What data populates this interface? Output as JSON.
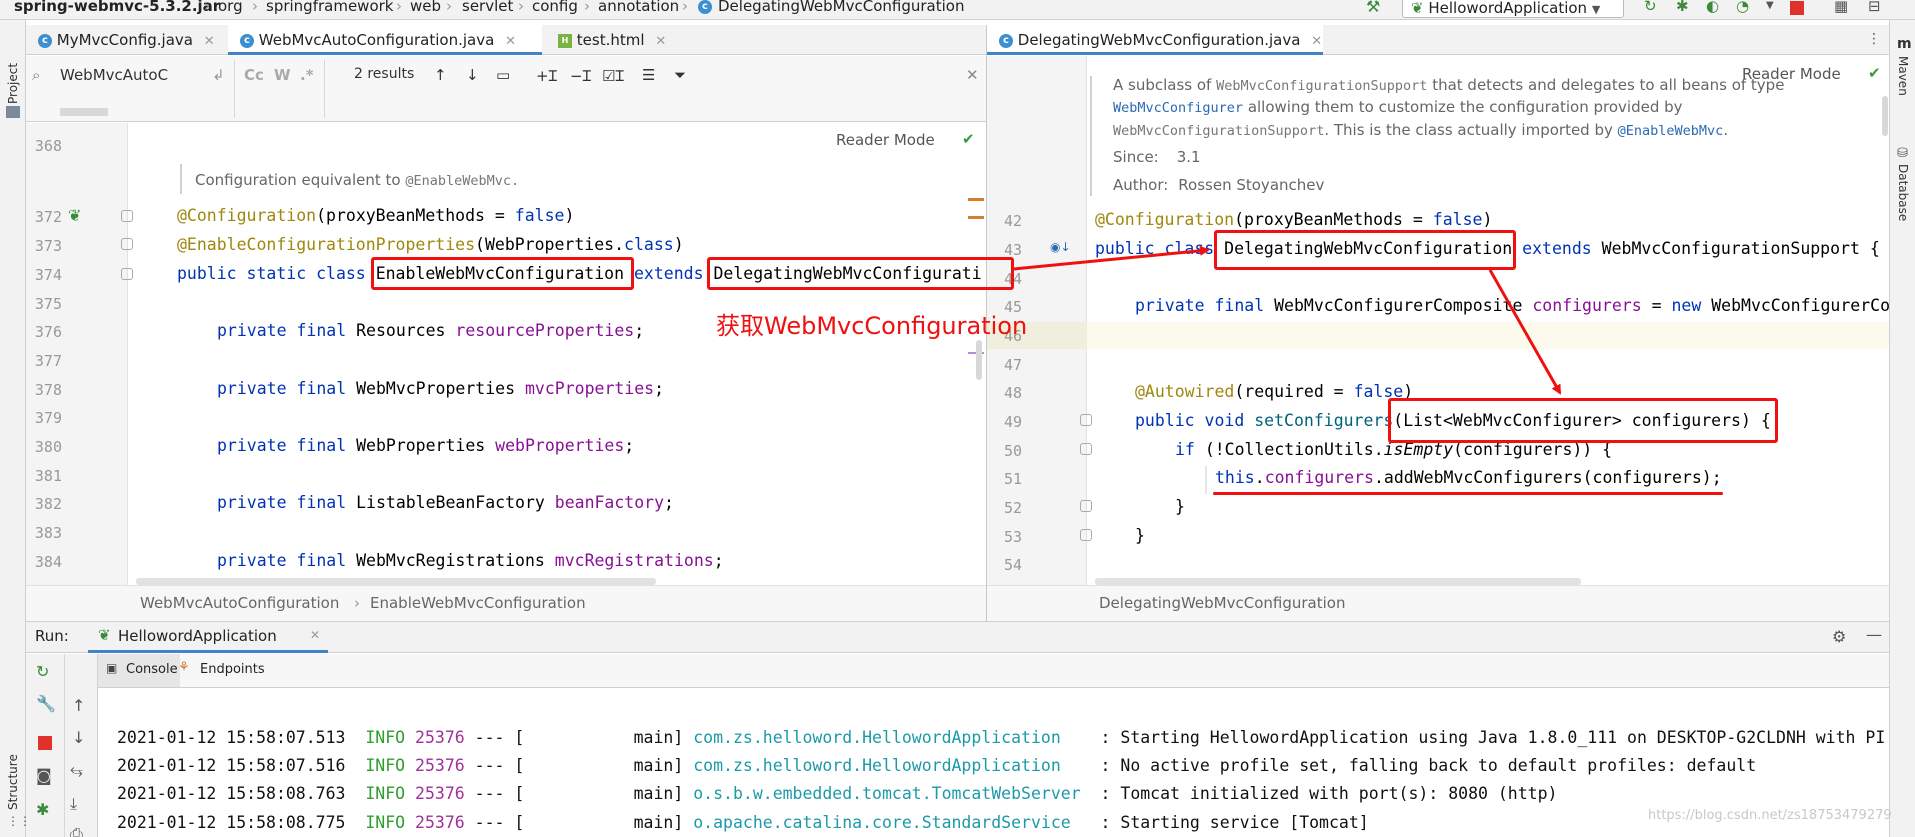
{
  "breadcrumb": [
    "spring-webmvc-5.3.2.jar",
    "org",
    "springframework",
    "web",
    "servlet",
    "config",
    "annotation",
    "DelegatingWebMvcConfiguration"
  ],
  "run_config": "HellowordApplication",
  "left_tool_labels": [
    "Project",
    "Structure"
  ],
  "right_tool_labels": [
    "Maven",
    "Database"
  ],
  "left_tabs": [
    {
      "label": "MyMvcConfig.java",
      "icon": "class-icon",
      "active": false
    },
    {
      "label": "WebMvcAutoConfiguration.java",
      "icon": "class-icon",
      "active": true
    },
    {
      "label": "test.html",
      "icon": "html-icon",
      "active": false
    }
  ],
  "right_tabs": [
    {
      "label": "DelegatingWebMvcConfiguration.java",
      "icon": "class-icon",
      "active": true
    }
  ],
  "find": {
    "query": "WebMvcAutoC",
    "results": "2 results",
    "case_label": "Cc",
    "word_label": "W",
    "regex_label": ".*"
  },
  "reader_mode": "Reader Mode",
  "left_editor": {
    "doc_comment": "Configuration equivalent to",
    "doc_code": "@EnableWebMvc.",
    "lines": {
      "368": "368",
      "372": "372",
      "373": "373",
      "374": "374",
      "375": "375",
      "376": "376",
      "377": "377",
      "378": "378",
      "379": "379",
      "380": "380",
      "381": "381",
      "382": "382",
      "383": "383",
      "384": "384"
    },
    "code": {
      "l372_ann": "@Configuration",
      "l372_rest": "(proxyBeanMethods = ",
      "l372_kw": "false",
      "l372_end": ")",
      "l373_ann": "@EnableConfigurationProperties",
      "l373_rest": "(WebProperties.",
      "l373_kw": "class",
      "l373_end": ")",
      "l374_kw": "public static class ",
      "l374_name": "EnableWebMvcConfiguration",
      "l374_ext": " extends ",
      "l374_super": "DelegatingWebMvcConfigurati",
      "l376_kw": "private final ",
      "l376_type": "Resources ",
      "l376_fld": "resourceProperties",
      "l376_end": ";",
      "l378_kw": "private final ",
      "l378_type": "WebMvcProperties ",
      "l378_fld": "mvcProperties",
      "l378_end": ";",
      "l380_kw": "private final ",
      "l380_type": "WebProperties ",
      "l380_fld": "webProperties",
      "l380_end": ";",
      "l382_kw": "private final ",
      "l382_type": "ListableBeanFactory ",
      "l382_fld": "beanFactory",
      "l382_end": ";",
      "l384_kw": "private final ",
      "l384_type": "WebMvcRegistrations ",
      "l384_fld": "mvcRegistrations",
      "l384_end": ";"
    },
    "annotation_text": "获取WebMvcConfiguration",
    "status": [
      "WebMvcAutoConfiguration",
      "EnableWebMvcConfiguration"
    ]
  },
  "right_editor": {
    "doc": {
      "p1": "A subclass of ",
      "c1": "WebMvcConfigurationSupport",
      "p2": " that detects and delegates to all beans of type",
      "c2": "WebMvcConfigurer",
      "p3": " allowing them to customize the configuration provided by",
      "c3": "WebMvcConfigurationSupport",
      "p4": ". This is the class actually imported by ",
      "c4": "@EnableWebMvc",
      "p5": ".",
      "since_label": "Since:",
      "since_value": "3.1",
      "author_label": "Author:",
      "author_value": "Rossen Stoyanchev"
    },
    "lines": {
      "42": "42",
      "43": "43",
      "44": "44",
      "45": "45",
      "46": "46",
      "47": "47",
      "48": "48",
      "49": "49",
      "50": "50",
      "51": "51",
      "52": "52",
      "53": "53",
      "54": "54"
    },
    "code": {
      "l42_ann": "@Configuration",
      "l42_rest": "(proxyBeanMethods = ",
      "l42_kw": "false",
      "l42_end": ")",
      "l43_kw": "public class ",
      "l43_name": "DelegatingWebMvcConfiguration",
      "l43_ext": " extends ",
      "l43_super": "WebMvcConfigurationSupport {",
      "l45_kw": "private final ",
      "l45_type": "WebMvcConfigurerComposite ",
      "l45_fld": "configurers",
      "l45_eq": " = ",
      "l45_new": "new ",
      "l45_rest": "WebMvcConfigurerCo",
      "l48_ann": "@Autowired",
      "l48_rest": "(required = ",
      "l48_kw": "false",
      "l48_end": ")",
      "l49_kw": "public void ",
      "l49_mth": "setConfigurers",
      "l49_rest": "(List<WebMvcConfigurer> configurers) {",
      "l50_kw": "if ",
      "l50_a": "(!CollectionUtils.",
      "l50_m": "isEmpty",
      "l50_b": "(configurers)) {",
      "l51_kw": "this",
      "l51_dot": ".",
      "l51_fld": "configurers",
      "l51_rest": ".addWebMvcConfigurers(configurers);",
      "l52": "}",
      "l53": "}"
    },
    "status": "DelegatingWebMvcConfiguration"
  },
  "run_panel": {
    "label": "Run:",
    "tab": "HellowordApplication",
    "subtabs": [
      "Console",
      "Endpoints"
    ],
    "logs": [
      {
        "ts": "2021-01-12 15:58:07.513",
        "level": "INFO",
        "pid": "25376",
        "sep": " --- [",
        "thread": "           main]",
        "logger": "com.zs.helloword.HellowordApplication   ",
        "msg": " : Starting HellowordApplication using Java 1.8.0_111 on DESKTOP-G2CLDNH with PI"
      },
      {
        "ts": "2021-01-12 15:58:07.516",
        "level": "INFO",
        "pid": "25376",
        "sep": " --- [",
        "thread": "           main]",
        "logger": "com.zs.helloword.HellowordApplication   ",
        "msg": " : No active profile set, falling back to default profiles: default"
      },
      {
        "ts": "2021-01-12 15:58:08.763",
        "level": "INFO",
        "pid": "25376",
        "sep": " --- [",
        "thread": "           main]",
        "logger": "o.s.b.w.embedded.tomcat.TomcatWebServer ",
        "msg": " : Tomcat initialized with port(s): 8080 (http)"
      },
      {
        "ts": "2021-01-12 15:58:08.775",
        "level": "INFO",
        "pid": "25376",
        "sep": " --- [",
        "thread": "           main]",
        "logger": "o.apache.catalina.core.StandardService  ",
        "msg": " : Starting service [Tomcat]"
      }
    ]
  },
  "watermark": "https://blog.csdn.net/zs18753479279",
  "colors": {
    "annotation_red": "#f01010",
    "keyword": "#0033b3",
    "field": "#871094",
    "info_green": "#2e9e2e"
  }
}
